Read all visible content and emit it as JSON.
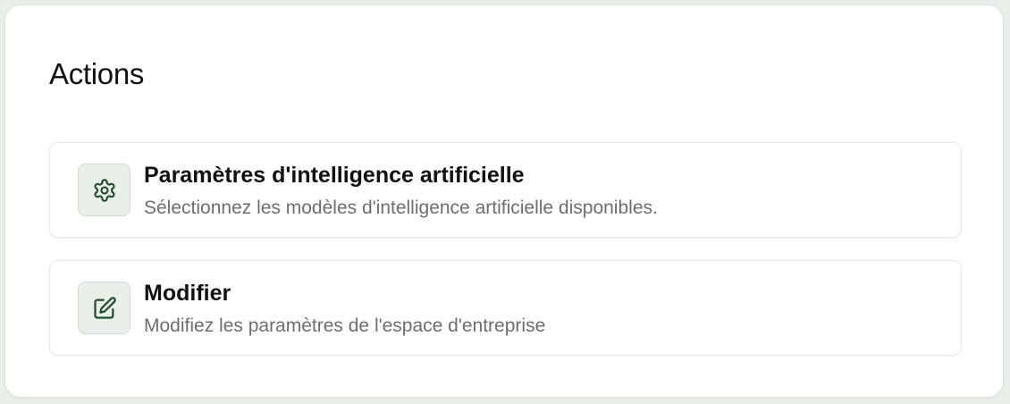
{
  "section": {
    "title": "Actions"
  },
  "actions": [
    {
      "icon": "gear-icon",
      "title": "Paramètres d'intelligence artificielle",
      "description": "Sélectionnez les modèles d'intelligence artificielle disponibles."
    },
    {
      "icon": "edit-icon",
      "title": "Modifier",
      "description": "Modifiez les paramètres de l'espace d'entreprise"
    }
  ],
  "colors": {
    "icon_stroke": "#1f4d2b",
    "icon_background": "#e9efe9",
    "page_background": "#e9efe9"
  }
}
